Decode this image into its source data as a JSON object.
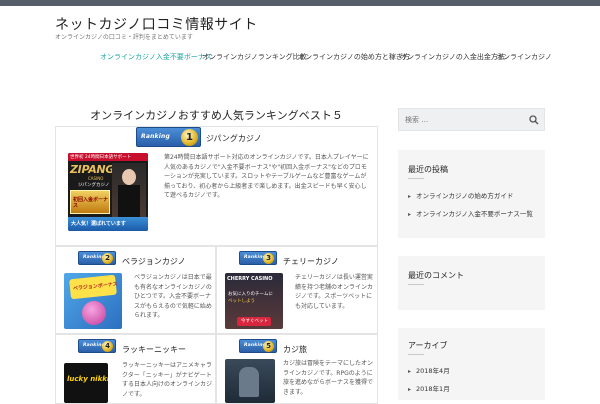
{
  "site": {
    "title": "ネットカジノ口コミ情報サイト",
    "description": "オンラインカジノの口コミ・評判をまとめています"
  },
  "nav": {
    "items": [
      {
        "label": "オンラインカジノ入金不要ボーナス"
      },
      {
        "label": "オンラインカジノランキング比較"
      },
      {
        "label": "オンラインカジノの始め方と稼ぎ方"
      },
      {
        "label": "オンラインカジノの入金出金方法"
      },
      {
        "label": "オンラインカジノ"
      }
    ],
    "active_index": 0
  },
  "main": {
    "heading": "オンラインカジノおすすめ人気ランキングベスト５",
    "rank_badge_text": "Ranking",
    "entries": [
      {
        "rank": "1",
        "name": "ジパングカジノ",
        "text": "第24時間日本語サポート対応のオンラインカジノです。日本人プレイヤーに人気のあるカジノで\"入金不要ボーナス\"や\"初回入金ボーナス\"などのプロモーションが充実しています。スロットやテーブルゲームなど豊富なゲームが揃っており、初心者から上級者まで楽しめます。出金スピードも早く安心して遊べるカジノです。",
        "thumb": {
          "brand": "ZIPANG",
          "sub": "CASINO",
          "kana": "ジパングカジノ",
          "top": "世界初 24時間日本語サポート",
          "banner": "初回入金ボーナス",
          "bottom": "大人気！選ばれています"
        }
      },
      {
        "rank": "2",
        "name": "ベラジョンカジノ",
        "text": "ベラジョンカジノは日本で最も有名なオンラインカジノのひとつです。入金不要ボーナスがもらえるので気軽に始められます。",
        "thumb": {
          "banner": "ベラジョンボーナス"
        }
      },
      {
        "rank": "3",
        "name": "チェリーカジノ",
        "text": "チェリーカジノは長い運営実績を持つ老舗のオンラインカジノです。スポーツベットにも対応しています。",
        "thumb": {
          "brand": "CHERRY CASINO",
          "line1": "お気に入りのチームに",
          "line2": "ベットしよう",
          "cta": "今すぐベット"
        }
      },
      {
        "rank": "4",
        "name": "ラッキーニッキー",
        "text": "ラッキーニッキーはアニメキャラクター「ニッキー」がナビゲートする日本人向けのオンラインカジノです。",
        "thumb": {
          "brand": "lucky nikki"
        }
      },
      {
        "rank": "5",
        "name": "カジ旅",
        "text": "カジ旅は冒険をテーマにしたオンラインカジノです。RPGのように旅を進めながらボーナスを獲得できます。",
        "thumb": {}
      }
    ]
  },
  "sidebar": {
    "search_placeholder": "検索 …",
    "recent": {
      "title": "最近の投稿",
      "items": [
        {
          "label": "オンラインカジノの始め方ガイド"
        },
        {
          "label": "オンラインカジノ入金不要ボーナス一覧"
        }
      ]
    },
    "comments": {
      "title": "最近のコメント"
    },
    "archives": {
      "title": "アーカイブ",
      "items": [
        {
          "label": "2018年4月"
        },
        {
          "label": "2018年1月"
        }
      ]
    }
  },
  "colors": {
    "topbar": "#565f69",
    "accent": "#1aa3a3",
    "widget_bg": "#f5f5f5",
    "badge_blue": "#2b5fa8"
  }
}
